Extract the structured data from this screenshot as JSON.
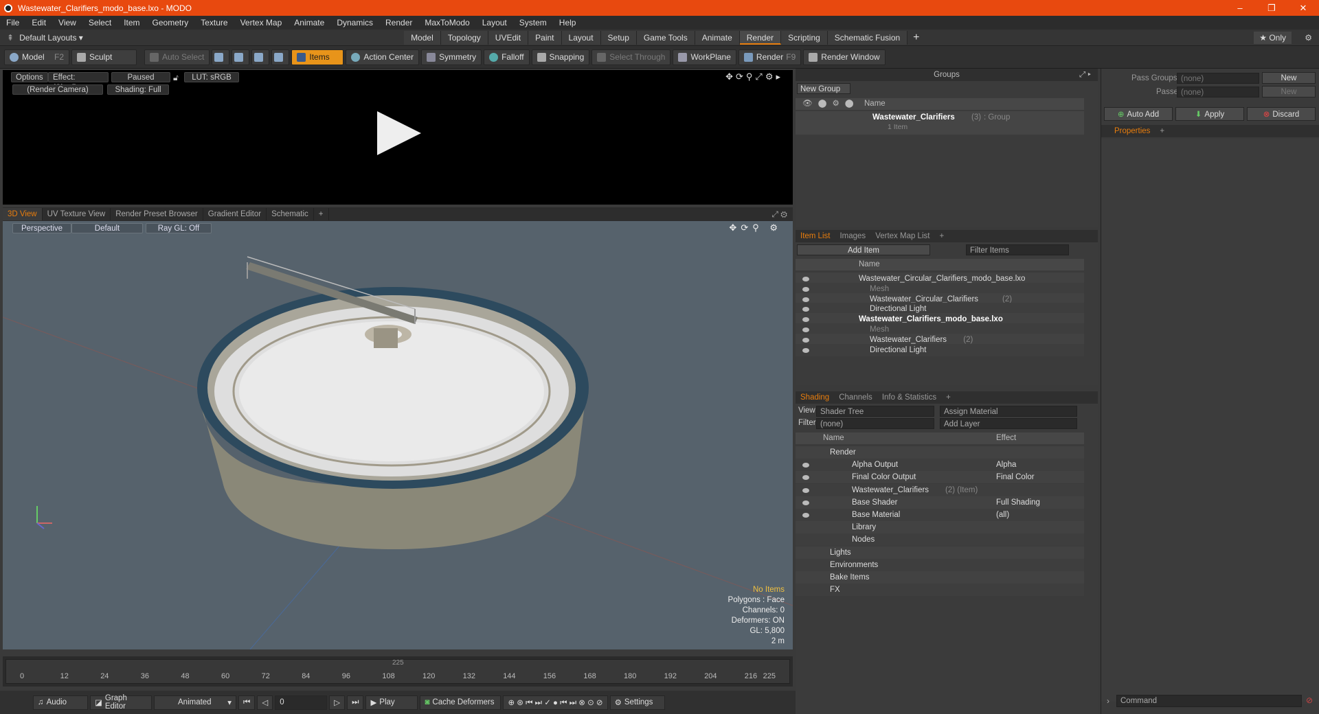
{
  "window": {
    "title": "Wastewater_Clarifiers_modo_base.lxo - MODO",
    "minimize": "–",
    "maximize": "❐",
    "close": "✕"
  },
  "menu": [
    "File",
    "Edit",
    "View",
    "Select",
    "Item",
    "Geometry",
    "Texture",
    "Vertex Map",
    "Animate",
    "Dynamics",
    "Render",
    "MaxToModo",
    "Layout",
    "System",
    "Help"
  ],
  "layouts": {
    "selector": "Default Layouts ▾",
    "tabs": [
      "Model",
      "Topology",
      "UVEdit",
      "Paint",
      "Layout",
      "Setup",
      "Game Tools",
      "Animate",
      "Render",
      "Scripting",
      "Schematic Fusion"
    ],
    "active": "Render",
    "add": "+",
    "only": "★ Only"
  },
  "toolbar": {
    "model": "Model",
    "model_key": "F2",
    "sculpt": "Sculpt",
    "auto_select": "Auto Select",
    "items": "Items",
    "action_center": "Action Center",
    "symmetry": "Symmetry",
    "falloff": "Falloff",
    "snapping": "Snapping",
    "select_through": "Select Through",
    "workplane": "WorkPlane",
    "render": "Render",
    "render_key": "F9",
    "render_window": "Render Window"
  },
  "render_view": {
    "options": "Options",
    "effect": "Effect: (Shadi...",
    "paused": "Paused",
    "lut": "LUT: sRGB",
    "camera": "(Render Camera)",
    "shading": "Shading: Full"
  },
  "view_tabs": [
    "3D View",
    "UV Texture View",
    "Render Preset Browser",
    "Gradient Editor",
    "Schematic",
    "+"
  ],
  "viewport": {
    "perspective": "Perspective",
    "default": "Default",
    "raygl": "Ray GL: Off",
    "info": {
      "no_items": "No Items",
      "polygons": "Polygons : Face",
      "channels": "Channels: 0",
      "deformers": "Deformers: ON",
      "gl": "GL: 5,800",
      "scale": "2 m"
    }
  },
  "timeline": {
    "ticks": [
      "0",
      "12",
      "24",
      "36",
      "48",
      "60",
      "72",
      "84",
      "96",
      "108",
      "120",
      "132",
      "144",
      "156",
      "168",
      "180",
      "192",
      "204",
      "216"
    ],
    "sub": "225",
    "end": "225"
  },
  "bottom": {
    "audio": "Audio",
    "graph_editor": "Graph Editor",
    "animated": "Animated",
    "frame": "0",
    "play": "Play",
    "cache": "Cache Deformers",
    "settings": "Settings"
  },
  "groups": {
    "title": "Groups",
    "new_group": "New Group",
    "col_name": "Name",
    "item": "Wastewater_Clarifiers",
    "item_count": "(3)",
    "item_type": ": Group",
    "sub": "1 Item"
  },
  "item_list": {
    "tabs": [
      "Item List",
      "Images",
      "Vertex Map List",
      "+"
    ],
    "add_item": "Add Item",
    "filter": "Filter Items",
    "col_name": "Name",
    "rows": [
      {
        "label": "Wastewater_Circular_Clarifiers_modo_base.lxo",
        "level": 0,
        "bold": false,
        "dim": false,
        "count": ""
      },
      {
        "label": "Mesh",
        "level": 1,
        "bold": false,
        "dim": true,
        "count": ""
      },
      {
        "label": "Wastewater_Circular_Clarifiers",
        "level": 1,
        "bold": false,
        "dim": false,
        "count": "(2)"
      },
      {
        "label": "Directional Light",
        "level": 1,
        "bold": false,
        "dim": false,
        "count": ""
      },
      {
        "label": "Wastewater_Clarifiers_modo_base.lxo",
        "level": 0,
        "bold": true,
        "dim": false,
        "count": ""
      },
      {
        "label": "Mesh",
        "level": 1,
        "bold": false,
        "dim": true,
        "count": ""
      },
      {
        "label": "Wastewater_Clarifiers",
        "level": 1,
        "bold": false,
        "dim": false,
        "count": "(2)"
      },
      {
        "label": "Directional Light",
        "level": 1,
        "bold": false,
        "dim": false,
        "count": ""
      }
    ]
  },
  "shading": {
    "tabs": [
      "Shading",
      "Channels",
      "Info & Statistics",
      "+"
    ],
    "view_label": "View",
    "view": "Shader Tree",
    "assign": "Assign Material",
    "filter_label": "Filter",
    "filter": "(none)",
    "add_layer": "Add Layer",
    "col_name": "Name",
    "col_effect": "Effect",
    "rows": [
      {
        "label": "Render",
        "effect": "",
        "level": 0,
        "eye": false
      },
      {
        "label": "Alpha Output",
        "effect": "Alpha",
        "level": 1,
        "eye": true
      },
      {
        "label": "Final Color Output",
        "effect": "Final Color",
        "level": 1,
        "eye": true
      },
      {
        "label": "Wastewater_Clarifiers",
        "effect": "",
        "level": 1,
        "eye": true,
        "suffix": "(2) (Item)"
      },
      {
        "label": "Base Shader",
        "effect": "Full Shading",
        "level": 1,
        "eye": true
      },
      {
        "label": "Base Material",
        "effect": "(all)",
        "level": 1,
        "eye": true
      },
      {
        "label": "Library",
        "effect": "",
        "level": 1,
        "eye": false
      },
      {
        "label": "Nodes",
        "effect": "",
        "level": 1,
        "eye": false
      },
      {
        "label": "Lights",
        "effect": "",
        "level": 0,
        "eye": false
      },
      {
        "label": "Environments",
        "effect": "",
        "level": 0,
        "eye": false
      },
      {
        "label": "Bake Items",
        "effect": "",
        "level": 0,
        "eye": false
      },
      {
        "label": "FX",
        "effect": "",
        "level": 0,
        "eye": false
      }
    ]
  },
  "right": {
    "pass_groups": "Pass Groups",
    "passes": "Passes",
    "none": "(none)",
    "new": "New",
    "auto_add": "Auto Add",
    "apply": "Apply",
    "discard": "Discard",
    "properties": "Properties",
    "plus": "+",
    "command": "Command"
  },
  "colors": {
    "accent": "#e8490f",
    "orange": "#e87d0d"
  }
}
